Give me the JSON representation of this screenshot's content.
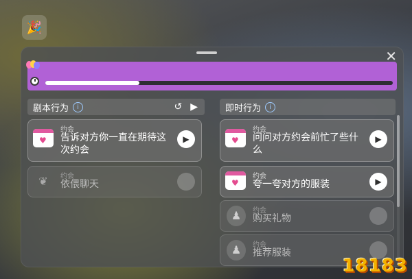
{
  "panel": {
    "close_icon": "✕",
    "progress": {
      "fraction": 0.27,
      "color": "#b161d6"
    }
  },
  "left_column": {
    "title": "剧本行为",
    "info_icon": "i",
    "history_icon": "↺",
    "play_icon": "▶",
    "cards": [
      {
        "category": "约会",
        "title": "告诉对方你一直在期待这次约会",
        "icon": "calendar-heart-icon",
        "enabled": true
      },
      {
        "category": "约会",
        "title": "依偎聊天",
        "icon": "leaf-icon",
        "enabled": false
      }
    ]
  },
  "right_column": {
    "title": "即时行为",
    "info_icon": "i",
    "cards": [
      {
        "category": "约会",
        "title": "问问对方约会前忙了些什么",
        "icon": "calendar-heart-icon",
        "enabled": true
      },
      {
        "category": "约会",
        "title": "夸一夸对方的服装",
        "icon": "calendar-heart-icon",
        "enabled": true
      },
      {
        "category": "约会",
        "title": "购买礼物",
        "icon": "person-icon",
        "enabled": false
      },
      {
        "category": "约会",
        "title": "推荐服装",
        "icon": "person-icon",
        "enabled": false
      }
    ]
  },
  "watermark": "18183"
}
